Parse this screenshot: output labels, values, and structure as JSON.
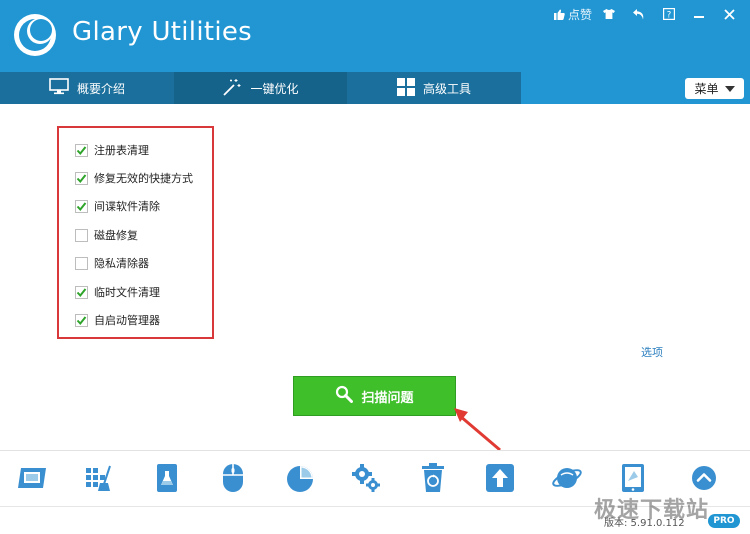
{
  "app": {
    "title": "Glary Utilities",
    "accent_color": "#2196d3"
  },
  "window_controls": [
    {
      "name": "like",
      "icon": "thumbs-up-icon",
      "label": "点赞"
    },
    {
      "name": "skin",
      "icon": "tshirt-icon",
      "label": ""
    },
    {
      "name": "back",
      "icon": "undo-icon",
      "label": ""
    },
    {
      "name": "help",
      "icon": "help-icon",
      "label": ""
    },
    {
      "name": "minimize",
      "icon": "minimize-icon",
      "label": ""
    },
    {
      "name": "close",
      "icon": "close-icon",
      "label": ""
    }
  ],
  "tabs": [
    {
      "label": "概要介绍",
      "icon": "monitor-icon"
    },
    {
      "label": "一键优化",
      "icon": "magic-wand-icon"
    },
    {
      "label": "高级工具",
      "icon": "grid-icon"
    }
  ],
  "menu": {
    "label": "菜单"
  },
  "options": [
    {
      "label": "注册表清理",
      "checked": true
    },
    {
      "label": "修复无效的快捷方式",
      "checked": true
    },
    {
      "label": "间谍软件清除",
      "checked": true
    },
    {
      "label": "磁盘修复",
      "checked": false
    },
    {
      "label": "隐私清除器",
      "checked": false
    },
    {
      "label": "临时文件清理",
      "checked": true
    },
    {
      "label": "自启动管理器",
      "checked": true
    }
  ],
  "options_link": "选项",
  "scan_button": {
    "label": "扫描问题",
    "icon": "search-icon"
  },
  "toolbar": [
    {
      "name": "disk-cleanup",
      "icon": "monitor-screen-icon"
    },
    {
      "name": "registry-repair",
      "icon": "broom-grid-icon"
    },
    {
      "name": "disk-analysis",
      "icon": "disk-beaker-icon"
    },
    {
      "name": "mouse-tools",
      "icon": "mouse-icon"
    },
    {
      "name": "disk-space",
      "icon": "pie-chart-icon"
    },
    {
      "name": "system-settings",
      "icon": "gears-icon"
    },
    {
      "name": "recycle",
      "icon": "trash-recycle-icon"
    },
    {
      "name": "upload",
      "icon": "upload-icon"
    },
    {
      "name": "internet",
      "icon": "planet-icon"
    },
    {
      "name": "backup",
      "icon": "tablet-icon"
    },
    {
      "name": "more",
      "icon": "chevron-up-icon"
    }
  ],
  "status": {
    "version": "版本: 5.91.0.112",
    "badge": "PRO"
  },
  "watermark": "极速下载站"
}
